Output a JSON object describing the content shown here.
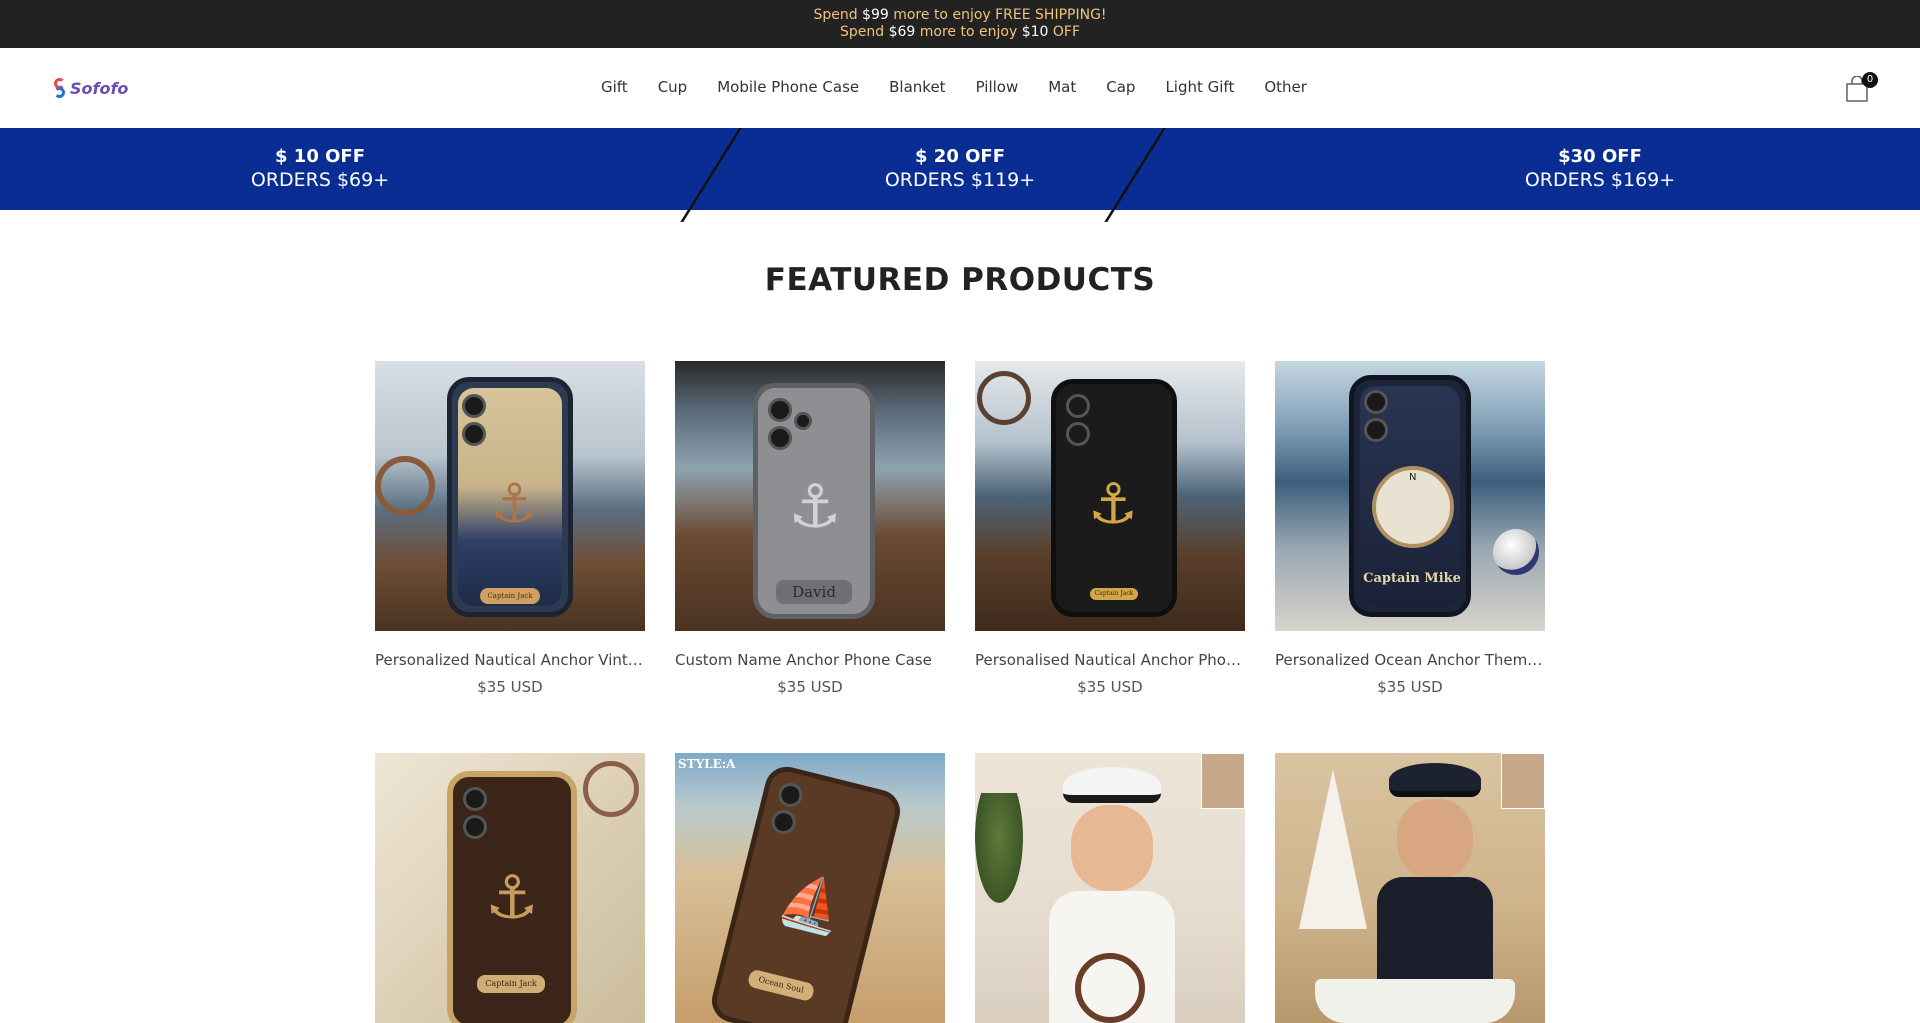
{
  "announcement": {
    "line1": [
      "Spend ",
      "$99",
      " more to enjoy FREE SHIPPING!"
    ],
    "line2": [
      "Spend ",
      "$69",
      " more to enjoy ",
      "$10",
      " OFF"
    ]
  },
  "header": {
    "logo_text": "Sofofo",
    "nav": [
      "Gift",
      "Cup",
      "Mobile Phone Case",
      "Blanket",
      "Pillow",
      "Mat",
      "Cap",
      "Light Gift",
      "Other"
    ],
    "cart_count": "0"
  },
  "promo": [
    {
      "top": "$ 10 OFF",
      "bottom": "ORDERS $69+"
    },
    {
      "top": "$ 20 OFF",
      "bottom": "ORDERS $119+"
    },
    {
      "top": "$30 OFF",
      "bottom": "ORDERS $169+"
    }
  ],
  "featured": {
    "title": "FEATURED PRODUCTS",
    "products": [
      {
        "name": "Personalized Nautical Anchor Vintage Phone Case",
        "price": "$35 USD",
        "plate": "Captain Jack"
      },
      {
        "name": "Custom Name Anchor Phone Case",
        "price": "$35 USD",
        "plate": "David"
      },
      {
        "name": "Personalised Nautical Anchor Phone Case",
        "price": "$35 USD",
        "plate": "Captain Jack"
      },
      {
        "name": "Personalized Ocean Anchor Themed Phone Case",
        "price": "$35 USD",
        "plate": "Captain Mike"
      },
      {
        "plate": "Captain Jack"
      },
      {
        "plate": "Ocean Soul",
        "tag": "STYLE:A"
      },
      {},
      {}
    ]
  },
  "colors": {
    "announce_bg": "#222222",
    "announce_text": "#f0c27a",
    "promo_bg": "#0a2d94"
  }
}
